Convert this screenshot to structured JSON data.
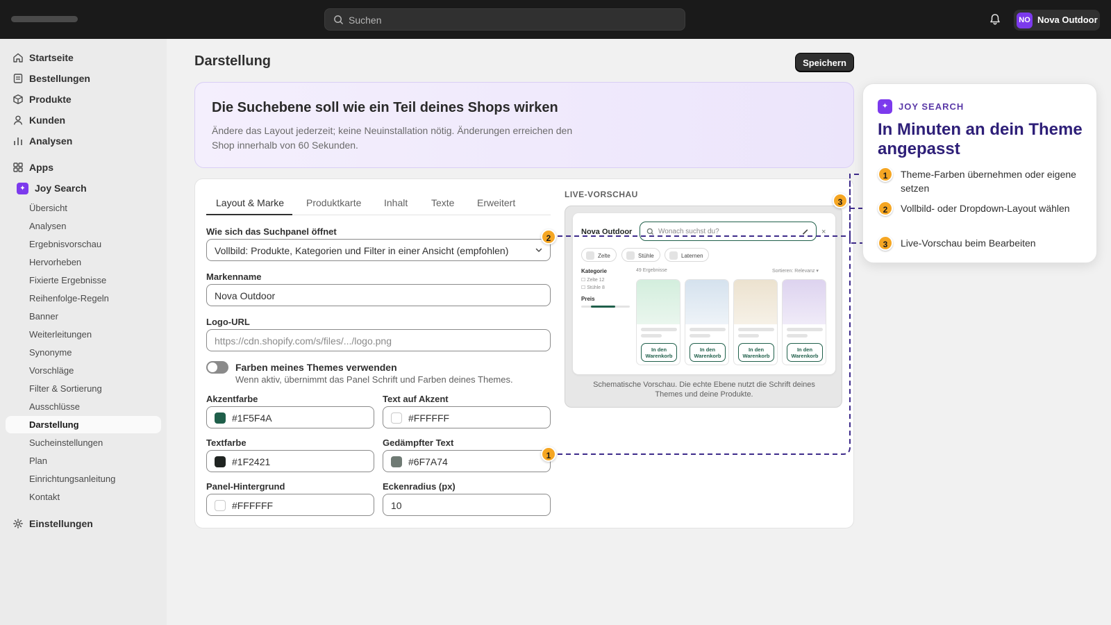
{
  "topbar": {
    "search_placeholder": "Suchen",
    "store_initials": "NO",
    "store_name": "Nova Outdoor"
  },
  "sidebar": {
    "main": [
      {
        "label": "Startseite",
        "icon": "home-icon"
      },
      {
        "label": "Bestellungen",
        "icon": "orders-icon"
      },
      {
        "label": "Produkte",
        "icon": "product-icon"
      },
      {
        "label": "Kunden",
        "icon": "customer-icon"
      },
      {
        "label": "Analysen",
        "icon": "chart-icon"
      }
    ],
    "apps_label": "Apps",
    "app_name": "Joy Search",
    "sub": [
      "Übersicht",
      "Analysen",
      "Ergebnisvorschau",
      "Hervorheben",
      "Fixierte Ergebnisse",
      "Reihenfolge-Regeln",
      "Banner",
      "Weiterleitungen",
      "Synonyme",
      "Vorschläge",
      "Filter & Sortierung",
      "Ausschlüsse",
      "Darstellung",
      "Sucheinstellungen",
      "Plan",
      "Einrichtungsanleitung",
      "Kontakt"
    ],
    "active_sub": "Darstellung",
    "settings_label": "Einstellungen"
  },
  "page": {
    "title": "Darstellung",
    "save_label": "Speichern"
  },
  "hero": {
    "title": "Die Suchebene soll wie ein Teil deines Shops wirken",
    "text": "Ändere das Layout jederzeit; keine Neuinstallation nötig. Änderungen erreichen den Shop innerhalb von 60 Sekunden."
  },
  "tabs": [
    "Layout & Marke",
    "Produktkarte",
    "Inhalt",
    "Texte",
    "Erweitert"
  ],
  "form": {
    "open_label": "Wie sich das Suchpanel öffnet",
    "open_value": "Vollbild: Produkte, Kategorien und Filter in einer Ansicht (empfohlen)",
    "brand_label": "Markenname",
    "brand_value": "Nova Outdoor",
    "logo_label": "Logo-URL",
    "logo_placeholder": "https://cdn.shopify.com/s/files/.../logo.png",
    "theme_toggle_label": "Farben meines Themes verwenden",
    "theme_toggle_help": "Wenn aktiv, übernimmt das Panel Schrift und Farben deines Themes.",
    "theme_toggle_on": false,
    "accent_label": "Akzentfarbe",
    "accent_value": "#1F5F4A",
    "on_accent_label": "Text auf Akzent",
    "on_accent_value": "#FFFFFF",
    "text_label": "Textfarbe",
    "text_value": "#1F2421",
    "muted_label": "Gedämpfter Text",
    "muted_value": "#6F7A74",
    "panel_bg_label": "Panel-Hintergrund",
    "panel_bg_value": "#FFFFFF",
    "radius_label": "Eckenradius (px)",
    "radius_value": "10"
  },
  "preview": {
    "label": "LIVE-VORSCHAU",
    "brand": "Nova Outdoor",
    "search_placeholder": "Wonach suchst du?",
    "close": "×",
    "chips": [
      "Zelte",
      "Stühle",
      "Laternen"
    ],
    "category_title": "Kategorie",
    "categories": [
      "☐ Zelte 12",
      "☐ Stühle 8"
    ],
    "price_title": "Preis",
    "result_count": "49 Ergebnisse",
    "sort": "Sortieren: Relevanz ▾",
    "add_to_cart": "In den Warenkorb",
    "caption": "Schematische Vorschau. Die echte Ebene nutzt die Schrift deines Themes und deine Produkte."
  },
  "callouts": [
    "1",
    "2",
    "3"
  ],
  "feature": {
    "eyebrow": "JOY SEARCH",
    "title": "In Minuten an dein Theme angepasst",
    "steps": [
      {
        "n": "1",
        "text": "Theme-Farben übernehmen oder eigene setzen"
      },
      {
        "n": "2",
        "text": "Vollbild- oder Dropdown-Layout wählen"
      },
      {
        "n": "3",
        "text": "Live-Vorschau beim Bearbeiten"
      }
    ]
  },
  "colors": {
    "accent": "#1F5F4A",
    "brand_purple": "#7C3AED",
    "callout": "#F5A623",
    "feature_title": "#2E1F78"
  }
}
